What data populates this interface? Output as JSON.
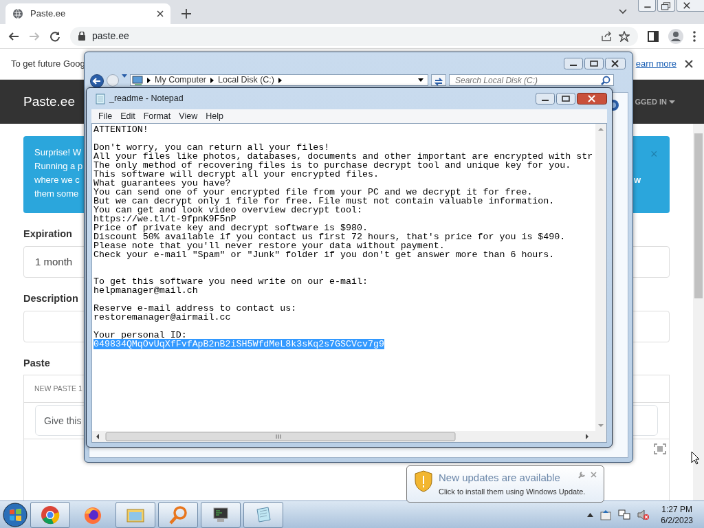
{
  "browser": {
    "tab": {
      "title": "Paste.ee"
    },
    "address": "paste.ee",
    "nav": [
      {
        "kind": "back",
        "disabled": false
      },
      {
        "kind": "forward",
        "disabled": true
      },
      {
        "kind": "reload",
        "disabled": false
      }
    ],
    "infobar": {
      "text": "To get future Goog",
      "link": "earn more"
    }
  },
  "site": {
    "brand": "Paste.ee",
    "account": "GGED IN",
    "alert": {
      "lines": [
        "Surprise! W",
        "Running a p",
        "where we c",
        "them some"
      ],
      "tail": "w",
      "close": "×"
    },
    "expiration": {
      "label": "Expiration",
      "value": "1 month"
    },
    "description": {
      "label": "Description"
    },
    "paste": {
      "label": "Paste",
      "tab": "NEW PASTE 1",
      "placeholder": "Give this"
    }
  },
  "explorer": {
    "breadcrumbs": [
      "My Computer",
      "Local Disk (C:)"
    ],
    "search_placeholder": "Search Local Disk (C:)"
  },
  "notepad": {
    "title": "_readme - Notepad",
    "menu": [
      "File",
      "Edit",
      "Format",
      "View",
      "Help"
    ],
    "paragraphs": [
      {
        "kind": "block",
        "lines": [
          {
            "text": "ATTENTION!",
            "selected": false
          }
        ]
      },
      {
        "kind": "block",
        "lines": [
          {
            "text": "Don't worry, you can return all your files!",
            "selected": false
          },
          {
            "text": "All your files like photos, databases, documents and other important are encrypted with str",
            "selected": false
          },
          {
            "text": "The only method of recovering files is to purchase decrypt tool and unique key for you.",
            "selected": false
          },
          {
            "text": "This software will decrypt all your encrypted files.",
            "selected": false
          },
          {
            "text": "What guarantees you have?",
            "selected": false
          },
          {
            "text": "You can send one of your encrypted file from your PC and we decrypt it for free.",
            "selected": false
          },
          {
            "text": "But we can decrypt only 1 file for free. File must not contain valuable information.",
            "selected": false
          },
          {
            "text": "You can get and look video overview decrypt tool:",
            "selected": false
          },
          {
            "text": "https://we.tl/t-9fpnK9F5nP",
            "selected": false
          },
          {
            "text": "Price of private key and decrypt software is $980.",
            "selected": false
          },
          {
            "text": "Discount 50% available if you contact us first 72 hours, that's price for you is $490.",
            "selected": false
          },
          {
            "text": "Please note that you'll never restore your data without payment.",
            "selected": false
          },
          {
            "text": "Check your e-mail \"Spam\" or \"Junk\" folder if you don't get answer more than 6 hours.",
            "selected": false
          }
        ]
      },
      {
        "kind": "section",
        "lines": [
          {
            "text": "To get this software you need write on our e-mail:",
            "selected": false
          },
          {
            "text": "helpmanager@mail.ch",
            "selected": false
          }
        ]
      },
      {
        "kind": "block",
        "lines": [
          {
            "text": "Reserve e-mail address to contact us:",
            "selected": false
          },
          {
            "text": "restoremanager@airmail.cc",
            "selected": false
          }
        ]
      },
      {
        "kind": "block",
        "lines": [
          {
            "text": "Your personal ID:",
            "selected": false
          },
          {
            "text": "049834QMqOvUqXfFvfApB2nB2iSH5WfdMeL8k3sKq2s7GSCVcv7g9",
            "selected": true
          }
        ]
      }
    ]
  },
  "notification": {
    "title": "New updates are available",
    "text": "Click to install them using Windows Update."
  },
  "taskbar": {
    "apps": [
      {
        "kind": "chrome",
        "running": true
      },
      {
        "kind": "firefox",
        "running": false
      },
      {
        "kind": "folder",
        "running": true
      },
      {
        "kind": "magnifier",
        "running": true
      },
      {
        "kind": "monitor",
        "running": true
      },
      {
        "kind": "notepad",
        "running": true
      }
    ],
    "time": "1:27 PM",
    "date": "6/2/2023"
  }
}
